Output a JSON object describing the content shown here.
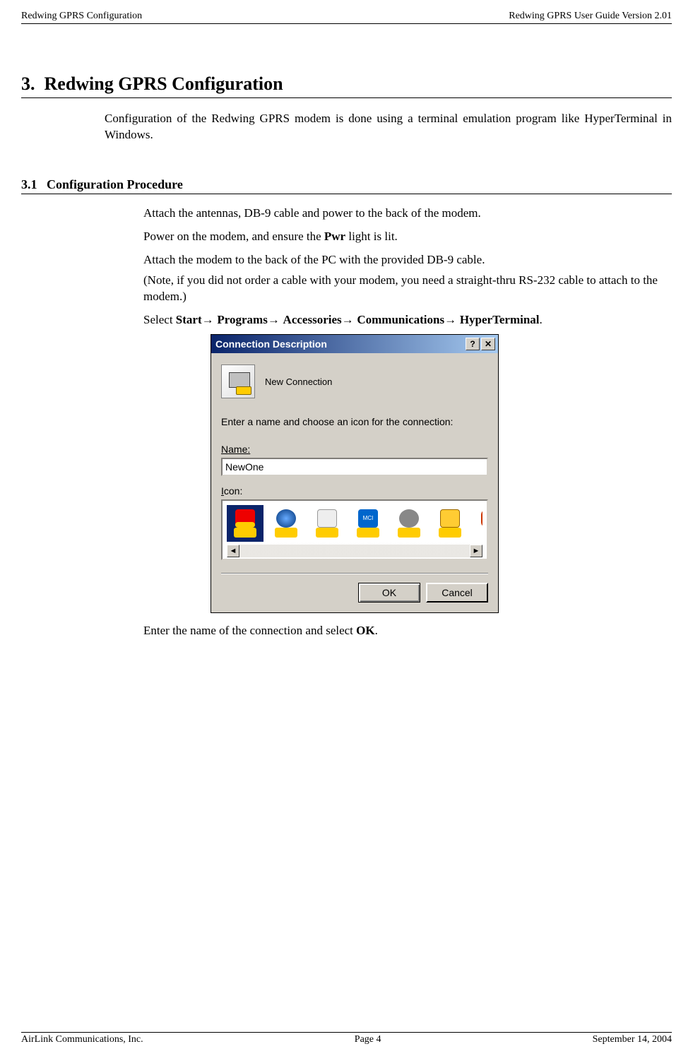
{
  "header": {
    "left": "Redwing GPRS Configuration",
    "right": "Redwing GPRS User Guide Version 2.01"
  },
  "chapter": {
    "number": "3.",
    "title": "Redwing GPRS Configuration"
  },
  "intro": "Configuration of the Redwing GPRS modem is done using a terminal emulation program like HyperTerminal in Windows.",
  "section": {
    "number": "3.1",
    "title": "Configuration Procedure"
  },
  "steps": {
    "s1": "Attach the antennas, DB-9 cable and power to the back of the modem.",
    "s2_pre": "Power on the modem, and ensure the ",
    "s2_bold": "Pwr",
    "s2_post": " light is lit.",
    "s3": "Attach the modem to the back of the PC with the provided DB-9 cable.",
    "s3_note": "(Note, if you did not order a cable with your modem, you need a straight-thru RS-232 cable to attach to the modem.)",
    "s4_pre": "Select ",
    "s4_b1": "Start",
    "s4_b2": "Programs",
    "s4_b3": "Accessories",
    "s4_b4": "Communications",
    "s4_b5": "HyperTerminal",
    "s5_pre": "Enter the name of the connection and select ",
    "s5_bold": "OK",
    "s5_post": "."
  },
  "dialog": {
    "title": "Connection Description",
    "help_btn": "?",
    "close_btn": "✕",
    "new_connection": "New Connection",
    "instruction": "Enter a name and choose an icon for the connection:",
    "name_label": "Name:",
    "name_value": "NewOne",
    "icon_label": "Icon:",
    "scroll_left": "◄",
    "scroll_right": "►",
    "ok": "OK",
    "cancel": "Cancel"
  },
  "footer": {
    "left": "AirLink Communications, Inc.",
    "center": "Page 4",
    "right": "September 14, 2004"
  }
}
